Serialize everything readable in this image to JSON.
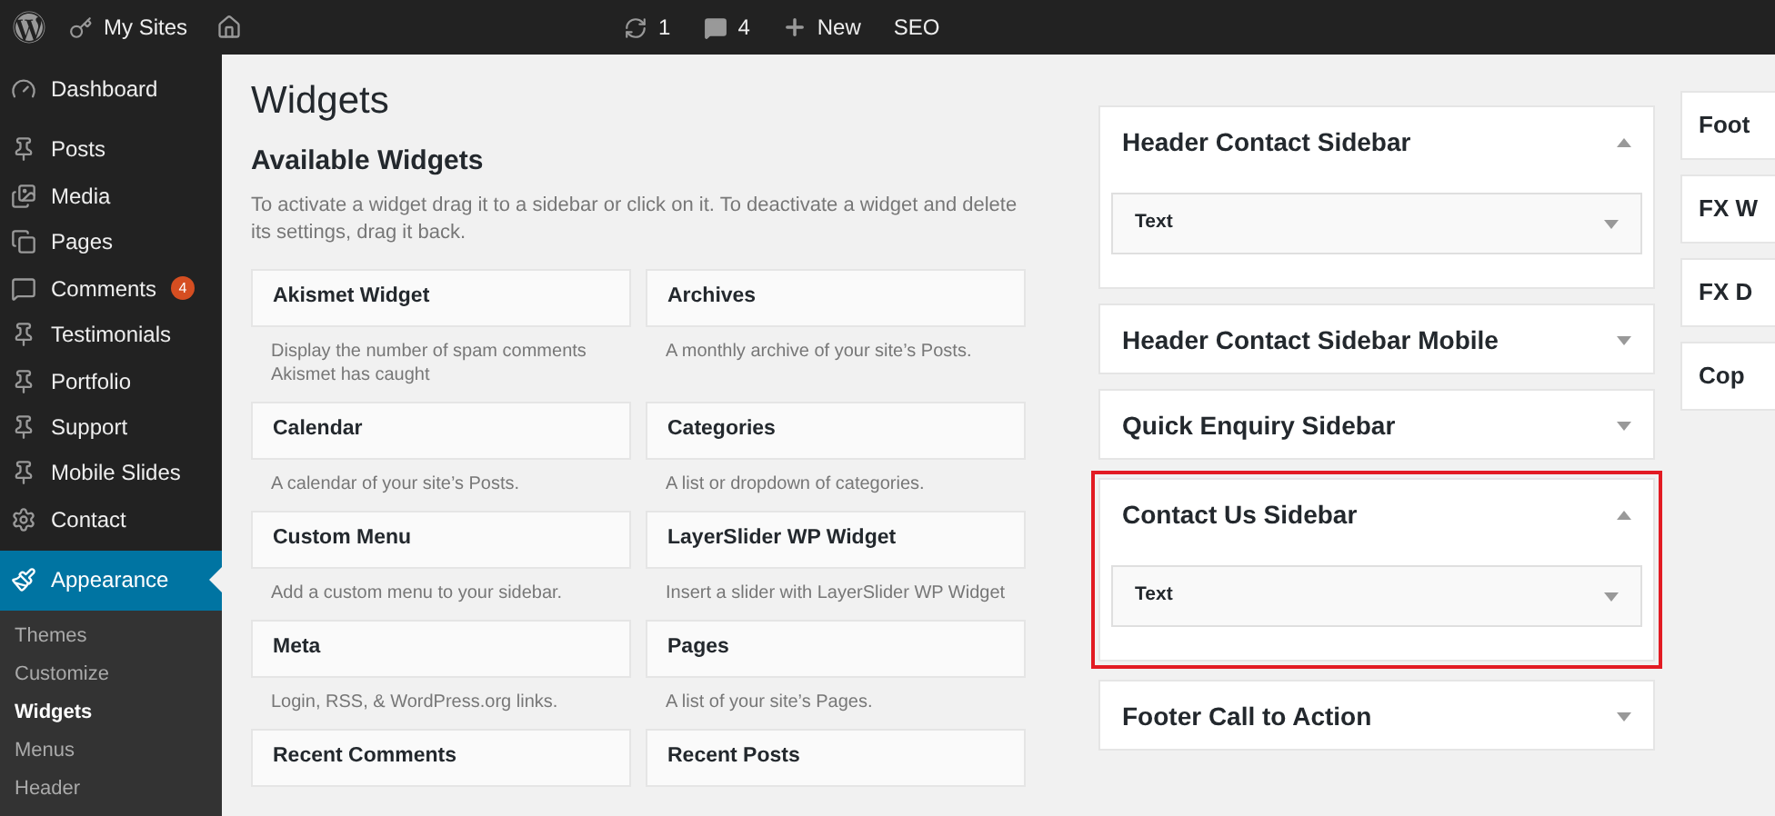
{
  "admin_bar": {
    "my_sites": "My Sites",
    "updates": "1",
    "comments": "4",
    "new": "New",
    "seo": "SEO"
  },
  "menu": [
    {
      "label": "Dashboard",
      "selected": false
    },
    {
      "label": "Posts",
      "selected": false
    },
    {
      "label": "Media",
      "selected": false
    },
    {
      "label": "Pages",
      "selected": false
    },
    {
      "label": "Comments",
      "selected": false,
      "badge": "4"
    },
    {
      "label": "Testimonials",
      "selected": false
    },
    {
      "label": "Portfolio",
      "selected": false
    },
    {
      "label": "Support",
      "selected": false
    },
    {
      "label": "Mobile Slides",
      "selected": false
    },
    {
      "label": "Contact",
      "selected": false
    },
    {
      "label": "Appearance",
      "selected": true
    }
  ],
  "submenu": [
    {
      "label": "Themes",
      "selected": false
    },
    {
      "label": "Customize",
      "selected": false
    },
    {
      "label": "Widgets",
      "selected": true
    },
    {
      "label": "Menus",
      "selected": false
    },
    {
      "label": "Header",
      "selected": false
    }
  ],
  "page_title": "Widgets",
  "available": {
    "title": "Available Widgets",
    "description": "To activate a widget drag it to a sidebar or click on it. To deactivate a widget and delete its settings, drag it back.",
    "widgets": [
      {
        "name": "Akismet Widget",
        "description": "Display the number of spam comments Akismet has caught"
      },
      {
        "name": "Archives",
        "description": "A monthly archive of your site’s Posts."
      },
      {
        "name": "Calendar",
        "description": "A calendar of your site’s Posts."
      },
      {
        "name": "Categories",
        "description": "A list or dropdown of categories."
      },
      {
        "name": "Custom Menu",
        "description": "Add a custom menu to your sidebar."
      },
      {
        "name": "LayerSlider WP Widget",
        "description": "Insert a slider with LayerSlider WP Widget"
      },
      {
        "name": "Meta",
        "description": "Login, RSS, & WordPress.org links."
      },
      {
        "name": "Pages",
        "description": "A list of your site’s Pages."
      },
      {
        "name": "Recent Comments"
      },
      {
        "name": "Recent Posts"
      }
    ]
  },
  "sidebars": [
    {
      "title": "Header Contact Sidebar",
      "expanded": true,
      "highlighted": false,
      "widgets": [
        "Text"
      ]
    },
    {
      "title": "Header Contact Sidebar Mobile",
      "expanded": false,
      "highlighted": false
    },
    {
      "title": "Quick Enquiry Sidebar",
      "expanded": false,
      "highlighted": false
    },
    {
      "title": "Contact Us Sidebar",
      "expanded": true,
      "highlighted": true,
      "widgets": [
        "Text"
      ]
    },
    {
      "title": "Footer Call to Action",
      "expanded": false,
      "highlighted": false
    }
  ],
  "sidebars_column_2": [
    {
      "title": "Foot"
    },
    {
      "title": "FX W"
    },
    {
      "title": "FX D"
    },
    {
      "title": "Cop"
    }
  ]
}
